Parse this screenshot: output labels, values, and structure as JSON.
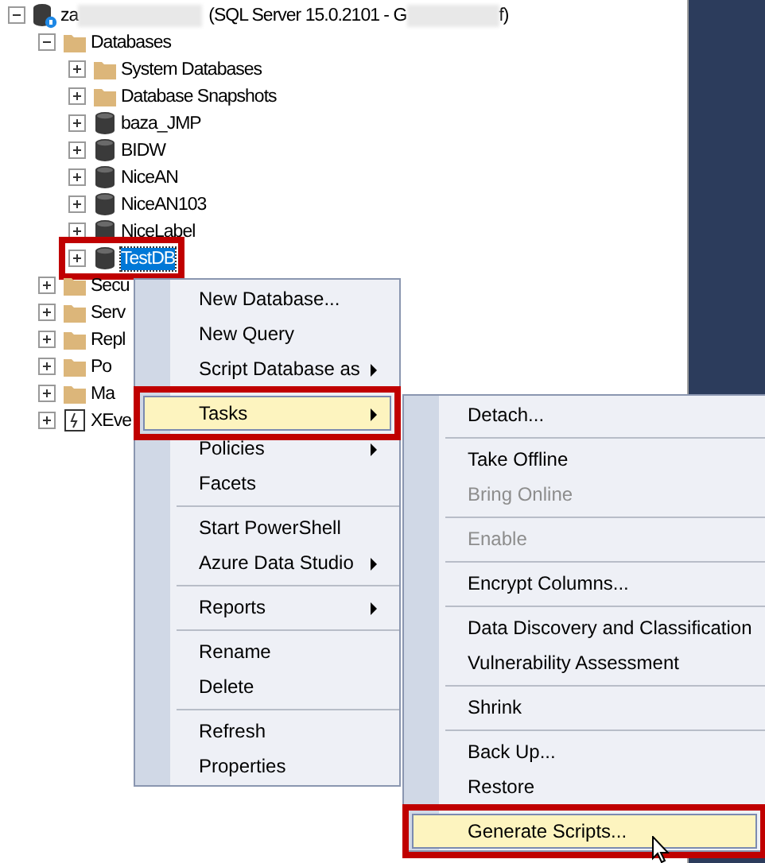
{
  "tree": {
    "label_start": "za",
    "label_end": "(SQL Server 15.0.2101 - G",
    "label_tail": "f)",
    "kind": "server",
    "expanded": true,
    "children": [
      {
        "label": "Databases",
        "kind": "folder",
        "expanded": true,
        "selected": false,
        "outlined": false,
        "children": [
          {
            "label": "System Databases",
            "kind": "folder",
            "expanded": false,
            "selected": false,
            "outlined": false
          },
          {
            "label": "Database Snapshots",
            "kind": "folder",
            "expanded": false,
            "selected": false,
            "outlined": false
          },
          {
            "label": "baza_JMP",
            "kind": "database",
            "expanded": false,
            "selected": false,
            "outlined": false
          },
          {
            "label": "BIDW",
            "kind": "database",
            "expanded": false,
            "selected": false,
            "outlined": false
          },
          {
            "label": "NiceAN",
            "kind": "database",
            "expanded": false,
            "selected": false,
            "outlined": false
          },
          {
            "label": "NiceAN103",
            "kind": "database",
            "expanded": false,
            "selected": false,
            "outlined": false
          },
          {
            "label": "NiceLabel",
            "kind": "database",
            "expanded": false,
            "selected": false,
            "outlined": false
          },
          {
            "label": "TestDB",
            "kind": "database",
            "expanded": false,
            "selected": true,
            "outlined": true
          }
        ]
      },
      {
        "label": "Secu",
        "kind": "folder",
        "expanded": false,
        "selected": false,
        "outlined": false
      },
      {
        "label": "Serv",
        "kind": "folder",
        "expanded": false,
        "selected": false,
        "outlined": false
      },
      {
        "label": "Repl",
        "kind": "folder",
        "expanded": false,
        "selected": false,
        "outlined": false
      },
      {
        "label": "Po",
        "kind": "folder",
        "expanded": false,
        "selected": false,
        "outlined": false
      },
      {
        "label": "Ma",
        "kind": "folder",
        "expanded": false,
        "selected": false,
        "outlined": false
      },
      {
        "label": "XEve",
        "kind": "xevent",
        "expanded": false,
        "selected": false,
        "outlined": false
      }
    ]
  },
  "context_menu": {
    "items": [
      {
        "kind": "item",
        "label": "New Database...",
        "submenu": false,
        "selected": false,
        "disabled": false,
        "outlined": false
      },
      {
        "kind": "item",
        "label": "New Query",
        "submenu": false,
        "selected": false,
        "disabled": false,
        "outlined": false
      },
      {
        "kind": "item",
        "label": "Script Database as",
        "submenu": true,
        "selected": false,
        "disabled": false,
        "outlined": false
      },
      {
        "kind": "separator"
      },
      {
        "kind": "item",
        "label": "Tasks",
        "submenu": true,
        "selected": true,
        "disabled": false,
        "outlined": true
      },
      {
        "kind": "item",
        "label": "Policies",
        "submenu": true,
        "selected": false,
        "disabled": false,
        "outlined": false
      },
      {
        "kind": "item",
        "label": "Facets",
        "submenu": false,
        "selected": false,
        "disabled": false,
        "outlined": false
      },
      {
        "kind": "separator"
      },
      {
        "kind": "item",
        "label": "Start PowerShell",
        "submenu": false,
        "selected": false,
        "disabled": false,
        "outlined": false
      },
      {
        "kind": "item",
        "label": "Azure Data Studio",
        "submenu": true,
        "selected": false,
        "disabled": false,
        "outlined": false
      },
      {
        "kind": "separator"
      },
      {
        "kind": "item",
        "label": "Reports",
        "submenu": true,
        "selected": false,
        "disabled": false,
        "outlined": false
      },
      {
        "kind": "separator"
      },
      {
        "kind": "item",
        "label": "Rename",
        "submenu": false,
        "selected": false,
        "disabled": false,
        "outlined": false
      },
      {
        "kind": "item",
        "label": "Delete",
        "submenu": false,
        "selected": false,
        "disabled": false,
        "outlined": false
      },
      {
        "kind": "separator"
      },
      {
        "kind": "item",
        "label": "Refresh",
        "submenu": false,
        "selected": false,
        "disabled": false,
        "outlined": false
      },
      {
        "kind": "item",
        "label": "Properties",
        "submenu": false,
        "selected": false,
        "disabled": false,
        "outlined": false
      }
    ]
  },
  "tasks_submenu": {
    "items": [
      {
        "kind": "item",
        "label": "Detach...",
        "submenu": false,
        "selected": false,
        "disabled": false,
        "outlined": false
      },
      {
        "kind": "separator"
      },
      {
        "kind": "item",
        "label": "Take Offline",
        "submenu": false,
        "selected": false,
        "disabled": false,
        "outlined": false
      },
      {
        "kind": "item",
        "label": "Bring Online",
        "submenu": false,
        "selected": false,
        "disabled": true,
        "outlined": false
      },
      {
        "kind": "separator"
      },
      {
        "kind": "item",
        "label": "Enable",
        "submenu": false,
        "selected": false,
        "disabled": true,
        "outlined": false
      },
      {
        "kind": "separator"
      },
      {
        "kind": "item",
        "label": "Encrypt Columns...",
        "submenu": false,
        "selected": false,
        "disabled": false,
        "outlined": false
      },
      {
        "kind": "separator"
      },
      {
        "kind": "item",
        "label": "Data Discovery and Classification",
        "submenu": false,
        "selected": false,
        "disabled": false,
        "outlined": false
      },
      {
        "kind": "item",
        "label": "Vulnerability Assessment",
        "submenu": false,
        "selected": false,
        "disabled": false,
        "outlined": false
      },
      {
        "kind": "separator"
      },
      {
        "kind": "item",
        "label": "Shrink",
        "submenu": false,
        "selected": false,
        "disabled": false,
        "outlined": false
      },
      {
        "kind": "separator"
      },
      {
        "kind": "item",
        "label": "Back Up...",
        "submenu": false,
        "selected": false,
        "disabled": false,
        "outlined": false
      },
      {
        "kind": "item",
        "label": "Restore",
        "submenu": false,
        "selected": false,
        "disabled": false,
        "outlined": false
      },
      {
        "kind": "separator"
      },
      {
        "kind": "item",
        "label": "Generate Scripts...",
        "submenu": false,
        "selected": true,
        "disabled": false,
        "outlined": true
      }
    ]
  }
}
